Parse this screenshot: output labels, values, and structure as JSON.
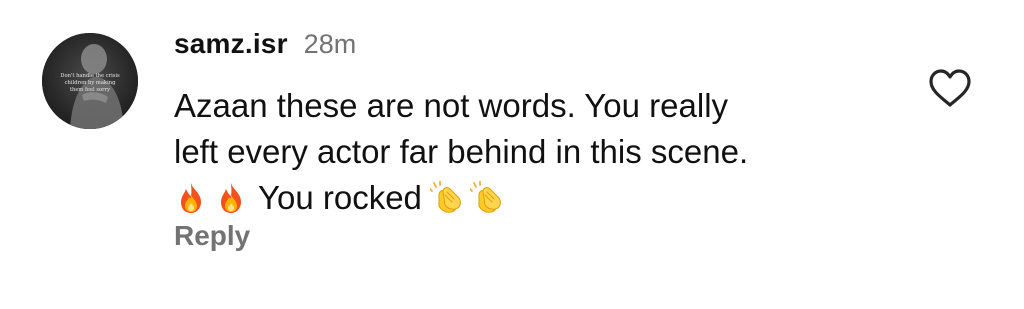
{
  "comment": {
    "username": "samz.isr",
    "timestamp": "28m",
    "line1": "Azaan these are not words. You really",
    "line2": "left every actor far behind in this scene.",
    "line3_text": "You rocked",
    "reply_label": "Reply",
    "avatar_caption_lines": [
      "Don't handle the crisis",
      "children by making",
      "them feel sorry"
    ],
    "emoji": {
      "fire": "fire-emoji",
      "clap": "clapping-hands-emoji"
    },
    "like_icon": "heart-outline-icon"
  }
}
